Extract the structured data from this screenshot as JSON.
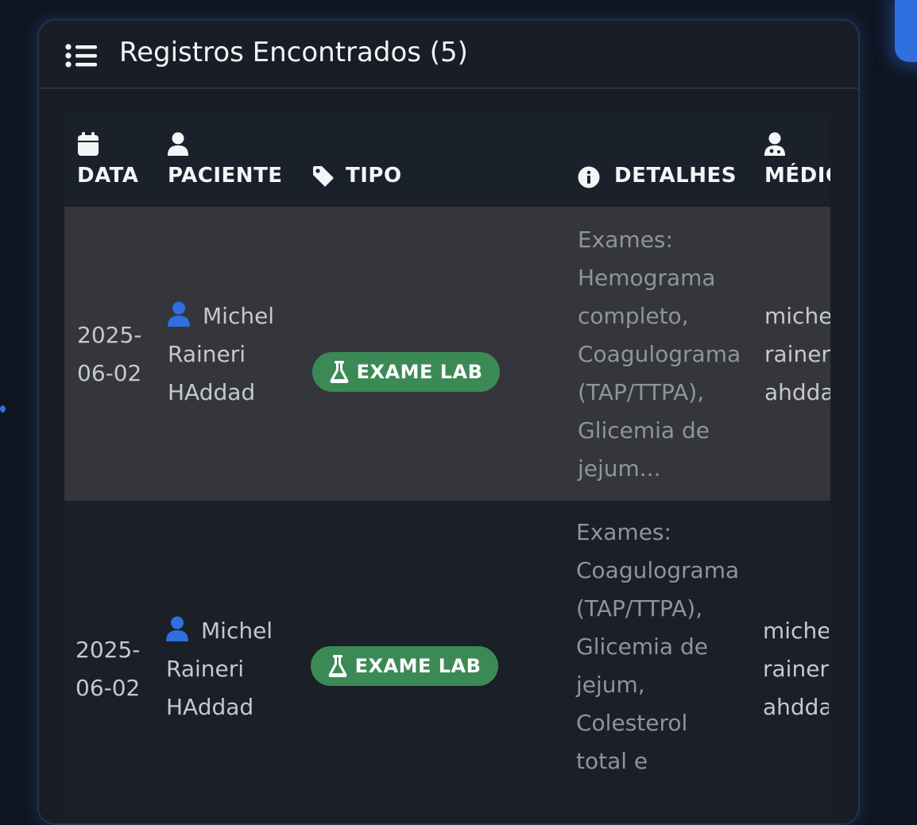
{
  "card": {
    "title": "Registros Encontrados (5)"
  },
  "table": {
    "headers": {
      "data": "DATA",
      "paciente": "PACIENTE",
      "tipo": "TIPO",
      "detalhes": "DETALHES",
      "medico": "MÉDIC"
    },
    "rows": [
      {
        "date_line1": "2025-",
        "date_line2": "06-02",
        "patient_line1": "Michel",
        "patient_line2": "Raineri",
        "patient_line3": "HAddad",
        "type": "EXAME LAB",
        "details": [
          "Exames:",
          "Hemograma",
          "completo,",
          "Coagulograma",
          "(TAP/TTPA),",
          "Glicemia de",
          "jejum..."
        ],
        "medico": [
          "miche",
          "rainer",
          "ahdda"
        ]
      },
      {
        "date_line1": "2025-",
        "date_line2": "06-02",
        "patient_line1": "Michel",
        "patient_line2": "Raineri",
        "patient_line3": "HAddad",
        "type": "EXAME LAB",
        "details": [
          "Exames:",
          "Coagulograma",
          "(TAP/TTPA),",
          "Glicemia de",
          "jejum,",
          "Colesterol",
          "total e"
        ],
        "medico": [
          "miche",
          "rainer",
          "ahdda"
        ]
      }
    ]
  },
  "colors": {
    "accent": "#2f6fe0",
    "badge_green": "#3b8a55",
    "highlight_row": "#34363b"
  },
  "icons": {
    "header": "list-icon",
    "data": "calendar-icon",
    "paciente": "user-icon",
    "tipo": "tag-icon",
    "detalhes": "info-circle-icon",
    "medico": "user-doctor-icon",
    "badge": "flask-icon"
  }
}
